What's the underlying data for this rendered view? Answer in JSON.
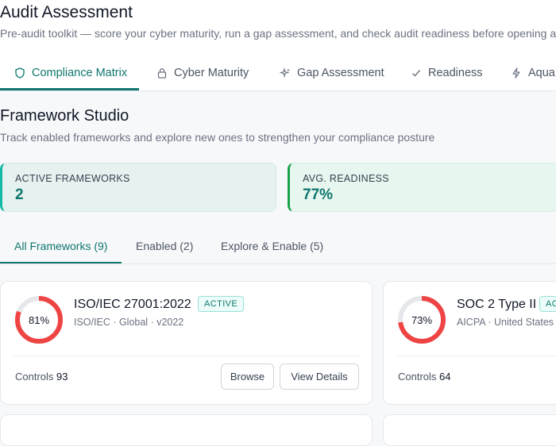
{
  "header": {
    "title": "Audit Assessment",
    "subtitle": "Pre-audit toolkit — score your cyber maturity, run a gap assessment, and check audit readiness before opening an au"
  },
  "main_tabs": [
    {
      "label": "Compliance Matrix",
      "icon": "shield-icon",
      "active": true
    },
    {
      "label": "Cyber Maturity",
      "icon": "lock-icon",
      "active": false
    },
    {
      "label": "Gap Assessment",
      "icon": "sparkle-icon",
      "active": false
    },
    {
      "label": "Readiness",
      "icon": "check-icon",
      "active": false
    },
    {
      "label": "Aqua",
      "icon": "lightning-icon",
      "active": false
    }
  ],
  "section": {
    "title": "Framework Studio",
    "subtitle": "Track enabled frameworks and explore new ones to strengthen your compliance posture"
  },
  "stats": {
    "active_label": "ACTIVE FRAMEWORKS",
    "active_value": "2",
    "readiness_label": "AVG. READINESS",
    "readiness_value": "77%"
  },
  "sub_tabs": [
    {
      "label": "All Frameworks (9)",
      "active": true
    },
    {
      "label": "Enabled (2)",
      "active": false
    },
    {
      "label": "Explore & Enable (5)",
      "active": false
    }
  ],
  "frameworks": [
    {
      "name": "ISO/IEC 27001:2022",
      "badge": "ACTIVE",
      "meta": "ISO/IEC · Global · v2022",
      "readiness_pct": 81,
      "readiness_label": "81%",
      "controls_label": "Controls",
      "controls_value": "93",
      "browse_label": "Browse",
      "details_label": "View Details"
    },
    {
      "name": "SOC 2 Type II",
      "badge": "ACTIVE",
      "meta": "AICPA · United States ·",
      "readiness_pct": 73,
      "readiness_label": "73%",
      "controls_label": "Controls",
      "controls_value": "64"
    }
  ],
  "colors": {
    "accent": "#0f766e",
    "ring_progress": "#ef4444",
    "ring_track": "#e5e7eb"
  }
}
